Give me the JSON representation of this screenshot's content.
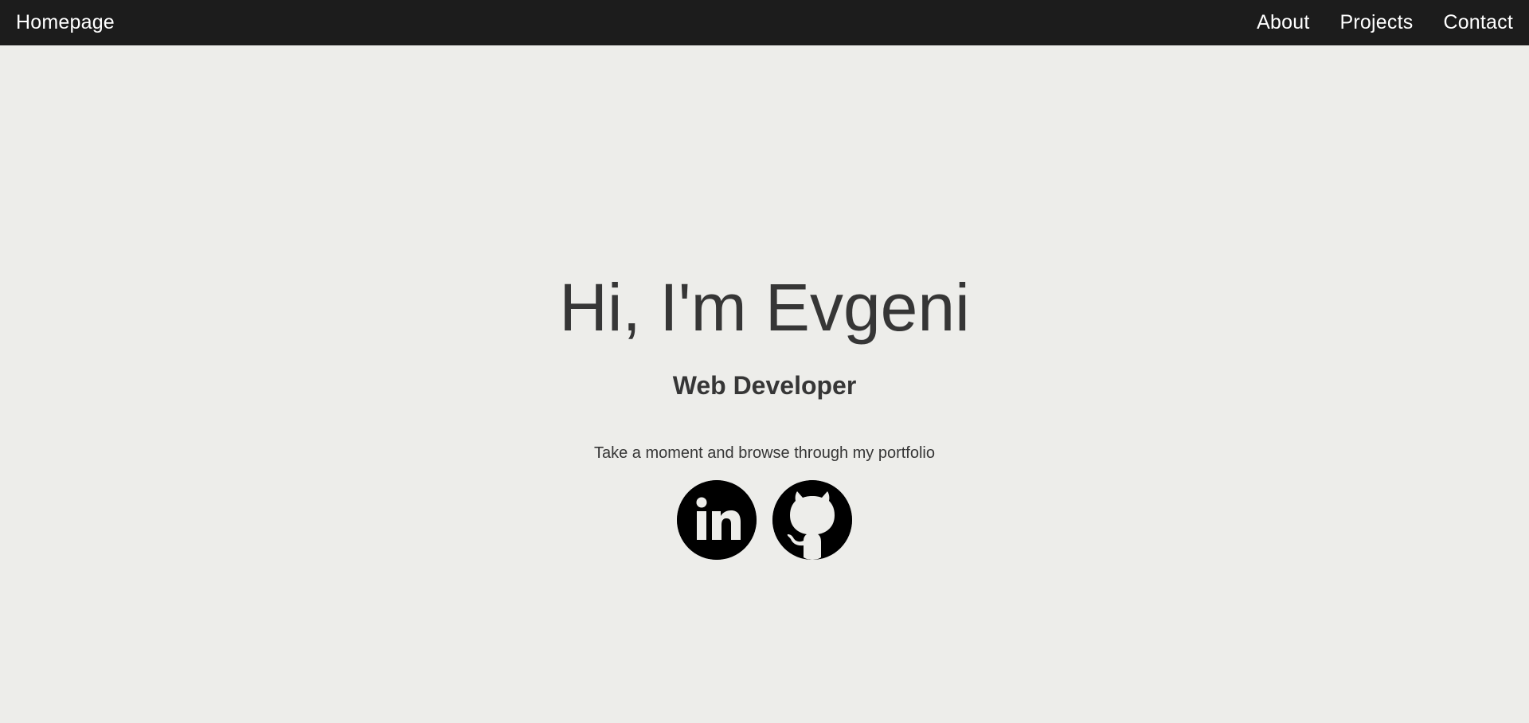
{
  "navbar": {
    "brand": "Homepage",
    "links": [
      {
        "label": "About"
      },
      {
        "label": "Projects"
      },
      {
        "label": "Contact"
      }
    ]
  },
  "hero": {
    "title": "Hi, I'm Evgeni",
    "subtitle": "Web Developer",
    "tagline": "Take a moment and browse through my portfolio"
  },
  "social": [
    {
      "icon": "linkedin-icon"
    },
    {
      "icon": "github-icon"
    }
  ],
  "colors": {
    "navbar_bg": "#1c1c1c",
    "page_bg": "#ededea",
    "text": "#363636",
    "nav_text": "#ffffff",
    "icon": "#000000"
  }
}
